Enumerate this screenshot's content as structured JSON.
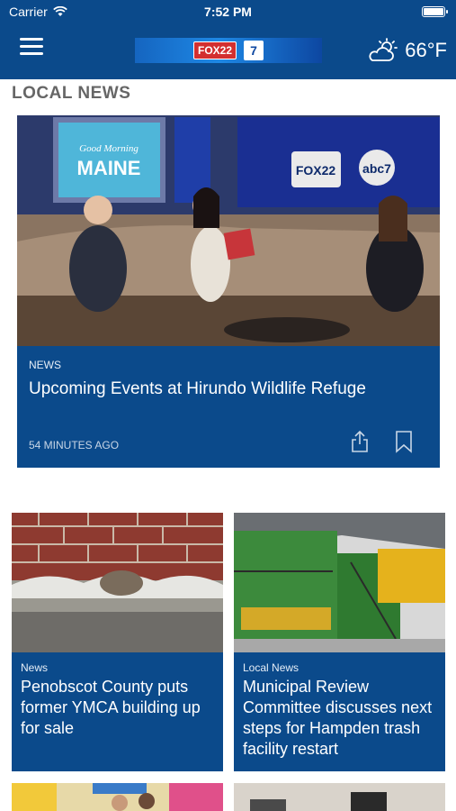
{
  "status_bar": {
    "carrier": "Carrier",
    "time": "7:52 PM"
  },
  "header": {
    "weather_temp": "66°F",
    "weather_icon": "partly-cloudy-icon",
    "logo_fox": "FOX22",
    "logo_abc": "7"
  },
  "section": {
    "title": "LOCAL NEWS"
  },
  "featured": {
    "category": "NEWS",
    "title": "Upcoming Events at Hirundo Wildlife Refuge",
    "time": "54 MINUTES AGO",
    "studio_sign": "Good Morning Maine",
    "studio_logos": "FOX 22 abc 7"
  },
  "cards": [
    {
      "category": "News",
      "title": "Penobscot County puts former YMCA building up for sale"
    },
    {
      "category": "Local News",
      "title": "Municipal Review Committee discusses next steps for Hampden trash facility restart"
    }
  ],
  "colors": {
    "brand": "#0b4a8b",
    "section_title": "#666666"
  }
}
